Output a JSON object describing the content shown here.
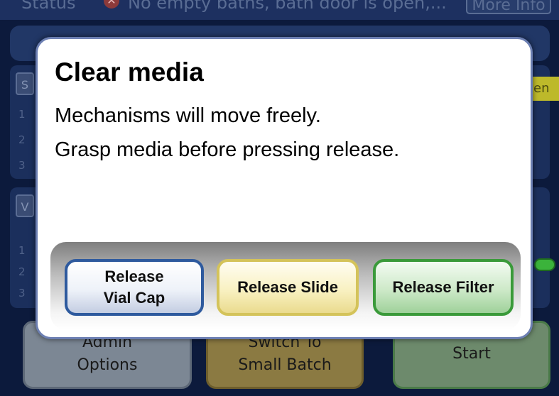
{
  "background": {
    "status_label": "Status",
    "status_message": "No empty baths, bath door is open,...",
    "more_info_label": "More Info",
    "panel1_tab": "S",
    "panel2_tab": "V",
    "open_tag": "en",
    "rows_panel1": [
      "1",
      "2",
      "3"
    ],
    "rows_panel2": [
      "1",
      "2",
      "3"
    ],
    "bottom_buttons": {
      "admin_line1": "Admin",
      "admin_line2": "Options",
      "switch_line1": "Switch To",
      "switch_line2": "Small Batch",
      "start": "Start"
    }
  },
  "dialog": {
    "title": "Clear media",
    "message_line1": "Mechanisms will move freely.",
    "message_line2": "Grasp media before pressing release.",
    "buttons": {
      "release_vial_cap_line1": "Release",
      "release_vial_cap_line2": "Vial Cap",
      "release_slide": "Release Slide",
      "release_filter": "Release Filter"
    }
  },
  "colors": {
    "vial_button_border": "#2e5a9e",
    "slide_button_border": "#d4c35a",
    "filter_button_border": "#3a9a3a",
    "modal_border": "#6c7fb2"
  },
  "icons": {
    "status_icon": "error-x-icon"
  }
}
